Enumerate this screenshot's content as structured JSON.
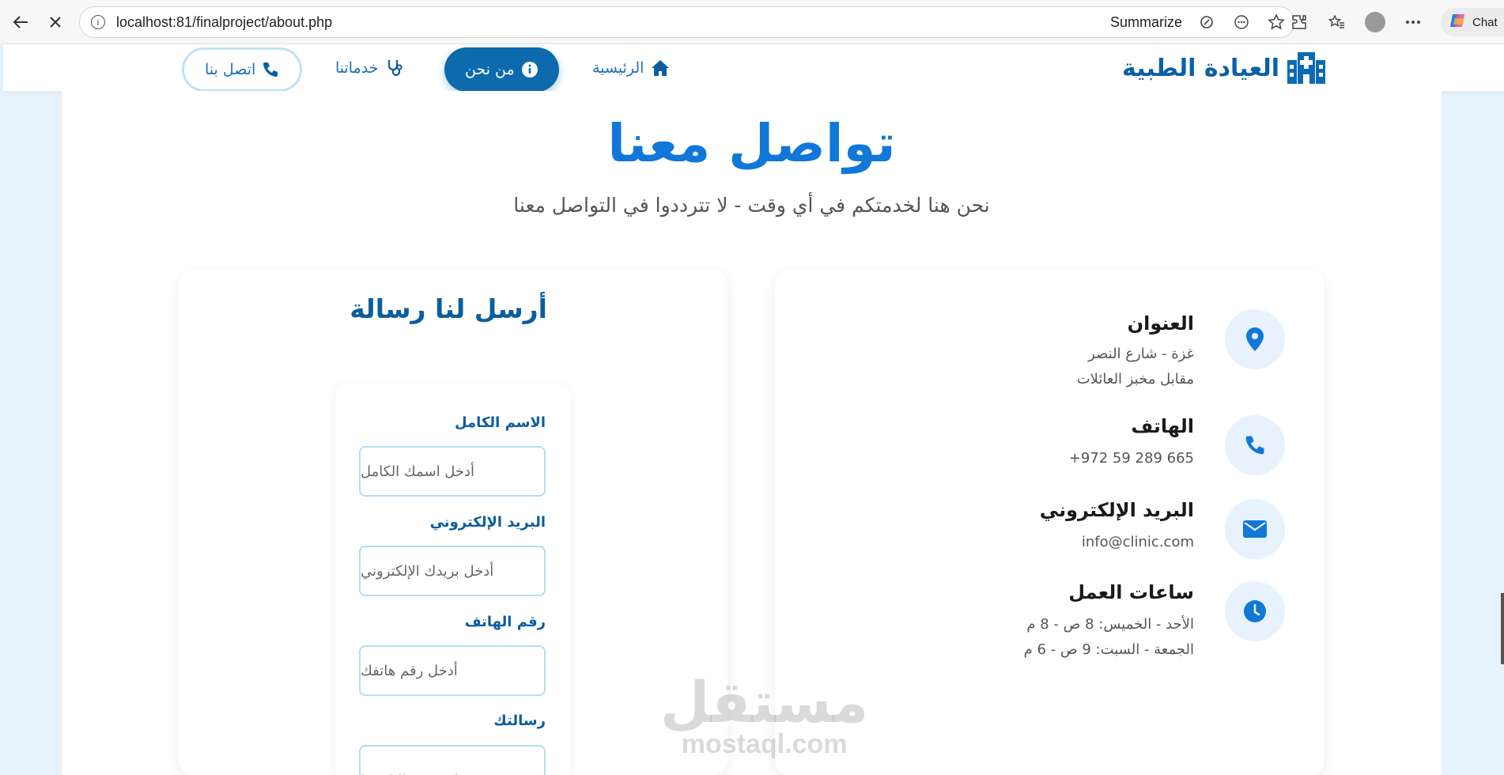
{
  "browser": {
    "url": "localhost:81/finalproject/about.php",
    "summarize_label": "Summarize",
    "chat_label": "Chat"
  },
  "nav": {
    "brand": "العيادة الطبية",
    "home": "الرئيسية",
    "about": "من نحن",
    "services": "خدماتنا",
    "contact": "اتصل بنا"
  },
  "hero": {
    "title": "تواصل معنا",
    "subtitle": "نحن هنا لخدمتكم في أي وقت - لا تترددوا في التواصل معنا"
  },
  "form": {
    "title": "أرسل لنا رسالة",
    "name_label": "الاسم الكامل",
    "name_placeholder": "أدخل اسمك الكامل",
    "email_label": "البريد الإلكتروني",
    "email_placeholder": "أدخل بريدك الإلكتروني",
    "phone_label": "رقم الهاتف",
    "phone_placeholder": "أدخل رقم هاتفك",
    "message_label": "رسالتك",
    "message_placeholder": "اكتب رسالتك هنا"
  },
  "info": {
    "address_title": "العنوان",
    "address_line1": "غزة - شارع النصر",
    "address_line2": "مقابل مخبز العائلات",
    "phone_title": "الهاتف",
    "phone_value": "+972 59 289 665",
    "email_title": "البريد الإلكتروني",
    "email_value": "info@clinic.com",
    "hours_title": "ساعات العمل",
    "hours_line1": "الأحد - الخميس: 8 ص - 8 م",
    "hours_line2": "الجمعة - السبت: 9 ص - 6 م"
  },
  "watermark": {
    "arabic": "مستقل",
    "latin": "mostaql.com"
  },
  "colors": {
    "primary": "#1177d9",
    "dark_blue": "#0c5d9e",
    "nav_active": "#0c6aad",
    "icon_bg": "#e7f2fd",
    "page_bg": "#e6f2fc"
  }
}
